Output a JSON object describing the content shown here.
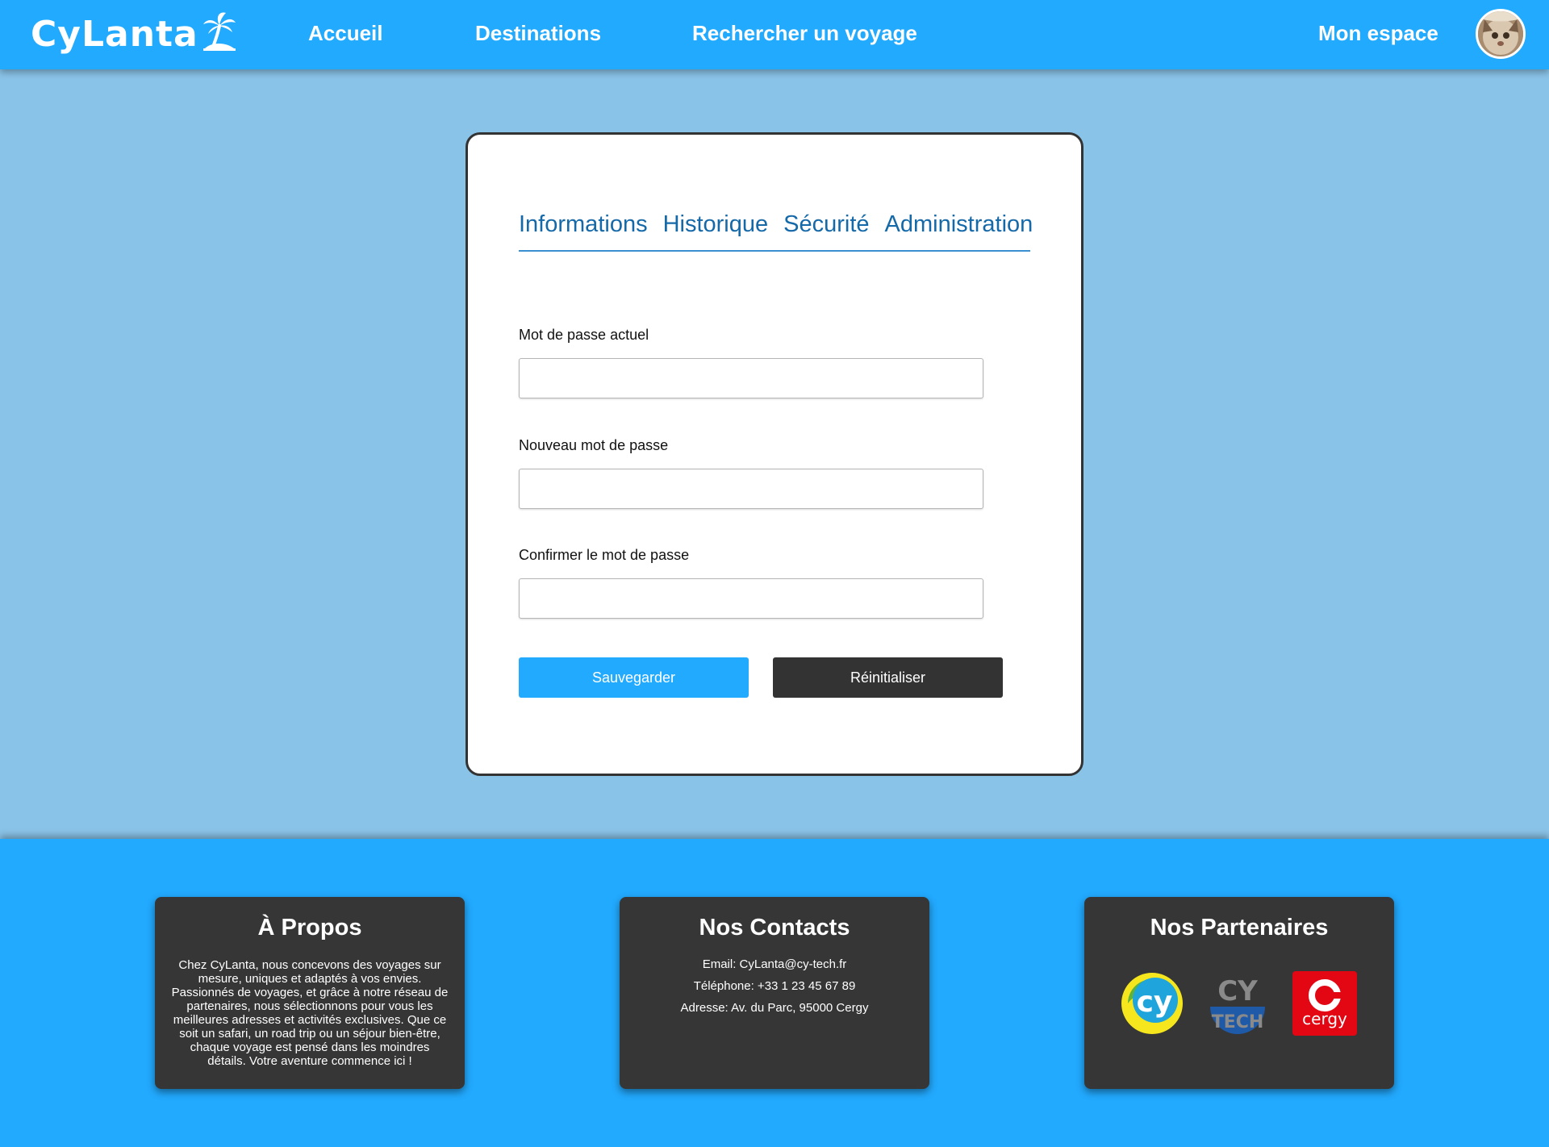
{
  "nav": {
    "brand": "CyLanta",
    "links": [
      "Accueil",
      "Destinations",
      "Rechercher un voyage"
    ],
    "account": "Mon espace"
  },
  "profile": {
    "tabs": [
      "Informations",
      "Historique",
      "Sécurité",
      "Administration"
    ],
    "active_tab": "Sécurité",
    "fields": [
      {
        "label": "Mot de passe actuel",
        "value": ""
      },
      {
        "label": "Nouveau mot de passe",
        "value": ""
      },
      {
        "label": "Confirmer le mot de passe",
        "value": ""
      }
    ],
    "save_label": "Sauvegarder",
    "reset_label": "Réinitialiser"
  },
  "footer": {
    "about": {
      "title": "À Propos",
      "text": "Chez CyLanta, nous concevons des voyages sur mesure, uniques et adaptés à vos envies. Passionnés de voyages, et grâce à notre réseau de partenaires, nous sélectionnons pour vous les meilleures adresses et activités exclusives. Que ce soit un safari, un road trip ou un séjour bien-être, chaque voyage est pensé dans les moindres détails. Votre aventure commence ici !"
    },
    "contacts": {
      "title": "Nos Contacts",
      "lines": [
        "Email: CyLanta@cy-tech.fr",
        "Téléphone: +33 1 23 45 67 89",
        "Adresse: Av. du Parc, 95000 Cergy"
      ]
    },
    "partners": {
      "title": "Nos Partenaires",
      "logos": [
        {
          "icon": "cy-university-logo",
          "text": "cy"
        },
        {
          "icon": "cy-tech-logo",
          "text": "CY TECH"
        },
        {
          "icon": "cergy-logo",
          "text": "cergy"
        }
      ]
    }
  },
  "colors": {
    "primary": "#22aaff",
    "page_bg": "#8ac3e8",
    "dark": "#333333",
    "tab_text": "#1669a8"
  }
}
